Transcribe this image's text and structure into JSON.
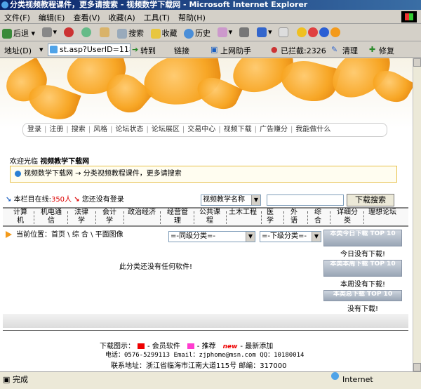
{
  "window": {
    "title": "分类视频教程课件，更多请搜索 - 视频数学下载网 - Microsoft Internet Explorer"
  },
  "menu": [
    "文件(F)",
    "编辑(E)",
    "查看(V)",
    "收藏(A)",
    "工具(T)",
    "帮助(H)"
  ],
  "toolbar": {
    "back": "后退",
    "search": "搜索",
    "favorites": "收藏",
    "history": "历史"
  },
  "address": {
    "label": "地址(D)",
    "url": "st.asp?UserID=118",
    "go": "转到",
    "links": "链接",
    "assistant": "上网助手",
    "blocked": "已拦截:2326",
    "clean": "清理",
    "repair": "修复"
  },
  "nav": [
    "登录",
    "注册",
    "搜索",
    "风格",
    "论坛状态",
    "论坛展区",
    "交易中心",
    "视频下载",
    "广告赚分",
    "我能做什么"
  ],
  "welcome": {
    "prefix": "欢迎光临",
    "site": "视频教学下载网"
  },
  "breadcrumb_bar": "视频数学下载网 → 分类视频教程课件，更多请搜索",
  "online": {
    "label": "本栏目在线:",
    "count": "350人",
    "status": "您还没有登录"
  },
  "search": {
    "select": "视频教学名称",
    "button": "下载搜索"
  },
  "categories": [
    "计算机",
    "机电通信",
    "法律学",
    "会计学",
    "政治经济",
    "经营管理",
    "公共课程",
    "土木工程",
    "医学",
    "外语",
    "综合",
    "详细分类",
    "理想论坛"
  ],
  "location": {
    "text": "当前位置：首页 \\ 综 合 \\ 平面图像",
    "same_level": "=-同级分类=-",
    "sub_level": "=-下级分类=-"
  },
  "empty_message": "此分类还没有任何软件!",
  "rank": [
    {
      "title": "本类今日下载 TOP 10",
      "empty": "今日没有下载!"
    },
    {
      "title": "本类本周下载 TOP 10",
      "empty": "本周没有下载!"
    },
    {
      "title": "本类总下载 TOP 10",
      "empty": "没有下载!"
    }
  ],
  "footer": {
    "legend_label": "下载图示：",
    "member": "会员软件",
    "recommend": "推荐",
    "new_tag": "new",
    "latest": "最新添加",
    "contact": "电话：0576-5299113 Email：zjphome@msn.com QQ：10180014",
    "address": "联系地址：浙江省临海市江南大道115号 邮编：317000"
  },
  "status": {
    "done": "完成",
    "zone": "Internet"
  }
}
